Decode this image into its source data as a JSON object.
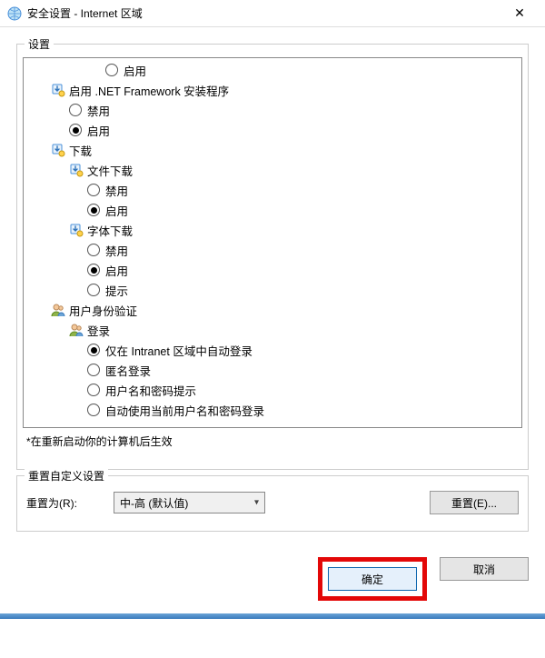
{
  "window": {
    "title": "安全设置 - Internet 区域",
    "close_symbol": "✕"
  },
  "settings_group": {
    "legend": "设置",
    "note": "*在重新启动你的计算机后生效"
  },
  "tree": [
    {
      "type": "radio",
      "indent": 3,
      "label": "启用",
      "selected": false
    },
    {
      "type": "category",
      "indent": 0,
      "icon": "net-icon",
      "label": "启用 .NET Framework 安装程序"
    },
    {
      "type": "radio",
      "indent": 1,
      "label": "禁用",
      "selected": false
    },
    {
      "type": "radio",
      "indent": 1,
      "label": "启用",
      "selected": true
    },
    {
      "type": "category",
      "indent": 0,
      "icon": "download-icon",
      "label": "下载"
    },
    {
      "type": "category",
      "indent": 1,
      "icon": "file-download-icon",
      "label": "文件下载"
    },
    {
      "type": "radio",
      "indent": 2,
      "label": "禁用",
      "selected": false
    },
    {
      "type": "radio",
      "indent": 2,
      "label": "启用",
      "selected": true
    },
    {
      "type": "category",
      "indent": 1,
      "icon": "font-download-icon",
      "label": "字体下载"
    },
    {
      "type": "radio",
      "indent": 2,
      "label": "禁用",
      "selected": false
    },
    {
      "type": "radio",
      "indent": 2,
      "label": "启用",
      "selected": true
    },
    {
      "type": "radio",
      "indent": 2,
      "label": "提示",
      "selected": false
    },
    {
      "type": "category",
      "indent": 0,
      "icon": "user-auth-icon",
      "label": "用户身份验证"
    },
    {
      "type": "category",
      "indent": 1,
      "icon": "login-icon",
      "label": "登录"
    },
    {
      "type": "radio",
      "indent": 2,
      "label": "仅在 Intranet 区域中自动登录",
      "selected": true
    },
    {
      "type": "radio",
      "indent": 2,
      "label": "匿名登录",
      "selected": false
    },
    {
      "type": "radio",
      "indent": 2,
      "label": "用户名和密码提示",
      "selected": false
    },
    {
      "type": "radio",
      "indent": 2,
      "label": "自动使用当前用户名和密码登录",
      "selected": false
    }
  ],
  "reset_group": {
    "legend": "重置自定义设置",
    "label": "重置为(R):",
    "combo_value": "中-高 (默认值)",
    "reset_button": "重置(E)..."
  },
  "footer": {
    "ok": "确定",
    "cancel": "取消"
  },
  "icons": {
    "net": "#4a90d9",
    "download": "#4a90d9",
    "user": "#8fb34a"
  }
}
